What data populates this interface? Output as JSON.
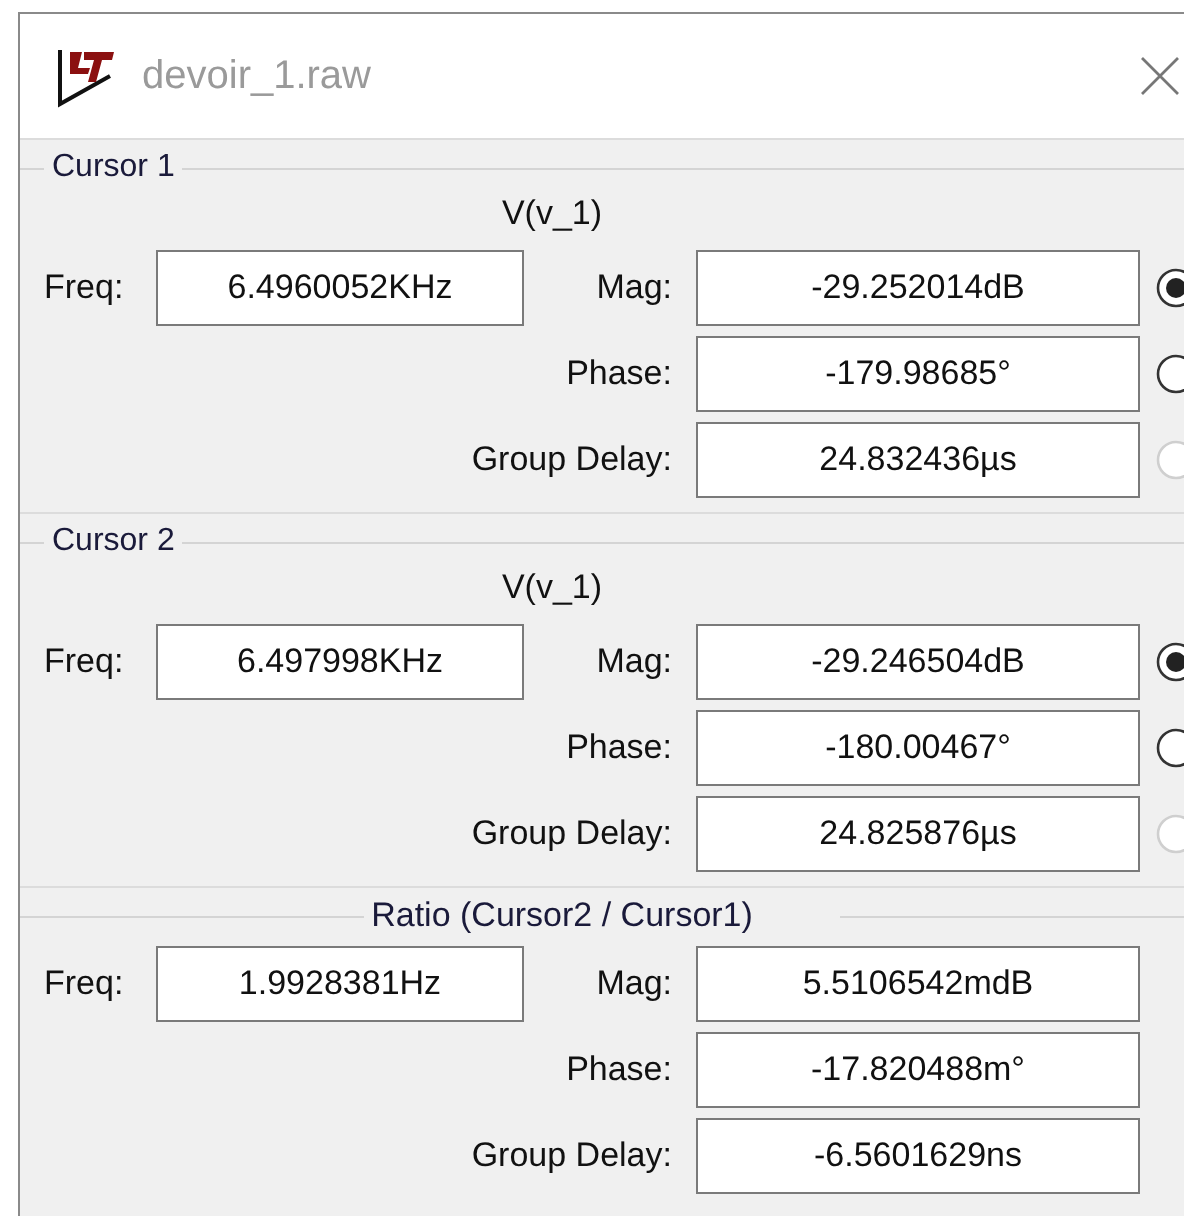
{
  "window": {
    "title": "devoir_1.raw"
  },
  "sections": [
    {
      "kind": "cursor",
      "label": "Cursor 1",
      "trace": "V(v_1)",
      "freq_label": "Freq:",
      "freq": "6.4960052KHz",
      "rows": [
        {
          "label": "Mag:",
          "value": "-29.252014dB",
          "selected": true,
          "disabled": false
        },
        {
          "label": "Phase:",
          "value": "-179.98685°",
          "selected": false,
          "disabled": false
        },
        {
          "label": "Group Delay:",
          "value": "24.832436µs",
          "selected": false,
          "disabled": true
        }
      ]
    },
    {
      "kind": "cursor",
      "label": "Cursor 2",
      "trace": "V(v_1)",
      "freq_label": "Freq:",
      "freq": "6.497998KHz",
      "rows": [
        {
          "label": "Mag:",
          "value": "-29.246504dB",
          "selected": true,
          "disabled": false
        },
        {
          "label": "Phase:",
          "value": "-180.00467°",
          "selected": false,
          "disabled": false
        },
        {
          "label": "Group Delay:",
          "value": "24.825876µs",
          "selected": false,
          "disabled": true
        }
      ]
    },
    {
      "kind": "ratio",
      "label": "Ratio (Cursor2 / Cursor1)",
      "freq_label": "Freq:",
      "freq": "1.9928381Hz",
      "rows": [
        {
          "label": "Mag:",
          "value": "5.5106542mdB"
        },
        {
          "label": "Phase:",
          "value": "-17.820488m°"
        },
        {
          "label": "Group Delay:",
          "value": "-6.5601629ns"
        }
      ]
    }
  ]
}
